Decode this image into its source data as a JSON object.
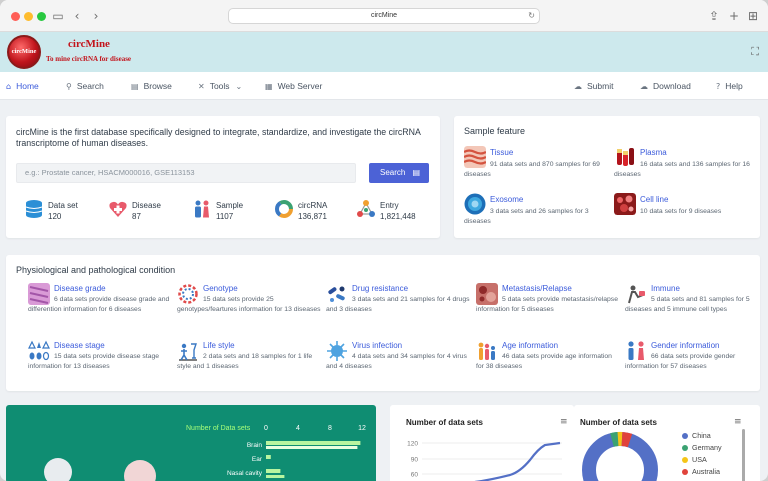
{
  "browser": {
    "url": "circMine"
  },
  "header": {
    "logo_text": "circMine",
    "title": "circMine",
    "subtitle": "To mine circRNA for disease"
  },
  "nav": {
    "home": "Home",
    "search": "Search",
    "browse": "Browse",
    "tools": "Tools",
    "web_server": "Web Server",
    "submit": "Submit",
    "download": "Download",
    "help": "Help"
  },
  "intro": {
    "text": "circMine is the first database specifically designed to integrate, standardize, and investigate the circRNA transcriptome of human diseases.",
    "search_placeholder": "e.g.: Prostate cancer, HSACM000016, GSE113153",
    "search_button": "Search"
  },
  "stats": [
    {
      "label": "Data set",
      "value": "120",
      "icon": "database-icon",
      "color": "#2b8fd6"
    },
    {
      "label": "Disease",
      "value": "87",
      "icon": "medical-heart-icon",
      "color": "#e85a6b"
    },
    {
      "label": "Sample",
      "value": "1107",
      "icon": "people-icon",
      "color": "#3a79c4"
    },
    {
      "label": "circRNA",
      "value": "136,871",
      "icon": "circle-ring-icon",
      "color": "#f0a030"
    },
    {
      "label": "Entry",
      "value": "1,821,448",
      "icon": "molecule-icon",
      "color": "#e04a4a"
    }
  ],
  "sample_feature": {
    "title": "Sample feature",
    "items": [
      {
        "name": "Tissue",
        "desc": "91 data sets and 870 samples for 69 diseases",
        "icon": "tissue-icon"
      },
      {
        "name": "Plasma",
        "desc": "16 data sets and 136 samples for 16 diseases",
        "icon": "plasma-tube-icon"
      },
      {
        "name": "Exosome",
        "desc": "3 data sets and 26 samples for 3 diseases",
        "icon": "exosome-icon"
      },
      {
        "name": "Cell line",
        "desc": "10 data sets for 9 diseases",
        "icon": "cell-line-icon"
      }
    ]
  },
  "physio": {
    "title": "Physiological and pathological condition",
    "items": [
      {
        "name": "Disease grade",
        "desc": "6 data sets provide disease grade and differention information for 6 diseases",
        "icon": "disease-grade-icon"
      },
      {
        "name": "Genotype",
        "desc": "15 data sets provide 25 genotypes/feartures information for 13 diseases",
        "icon": "genotype-icon"
      },
      {
        "name": "Drug resistance",
        "desc": "3 data sets and 21 samples for 4 drugs and 3 diseases",
        "icon": "drug-icon"
      },
      {
        "name": "Metastasis/Relapse",
        "desc": "5 data sets provide metastasis/relapse information for 5 diseases",
        "icon": "metastasis-icon"
      },
      {
        "name": "Immune",
        "desc": "5 data sets and 81 samples for 5 diseases and 5 immune cell types",
        "icon": "immune-icon"
      },
      {
        "name": "Disease stage",
        "desc": "15 data sets provide disease stage information for 13 diseases",
        "icon": "disease-stage-icon"
      },
      {
        "name": "Life style",
        "desc": "2 data sets and 18 samples for 1 life style and 1 diseases",
        "icon": "life-style-icon"
      },
      {
        "name": "Virus infection",
        "desc": "4 data sets and 34 samples for 4 virus and 4 diseases",
        "icon": "virus-icon"
      },
      {
        "name": "Age information",
        "desc": "46 data sets provide age information for 38 diseases",
        "icon": "age-icon"
      },
      {
        "name": "Gender information",
        "desc": "66 data sets provide gender information for 57 diseases",
        "icon": "gender-icon"
      }
    ]
  },
  "chart_data": [
    {
      "type": "bar",
      "title": "Number of Data sets",
      "categories": [
        "Brain",
        "Ear",
        "Nasal cavity"
      ],
      "values": [
        11.8,
        0.6,
        1.8
      ],
      "xticks": [
        "0",
        "4",
        "8",
        "12"
      ],
      "xlim": [
        0,
        12
      ]
    },
    {
      "type": "line",
      "title": "Number of data sets",
      "yticks": [
        "120",
        "90",
        "60"
      ]
    },
    {
      "type": "pie",
      "title": "Number of data sets",
      "legend": [
        {
          "name": "China",
          "color": "#5470c6"
        },
        {
          "name": "Germany",
          "color": "#3ba272"
        },
        {
          "name": "USA",
          "color": "#f5c518"
        },
        {
          "name": "Australia",
          "color": "#e0433b"
        }
      ]
    }
  ]
}
